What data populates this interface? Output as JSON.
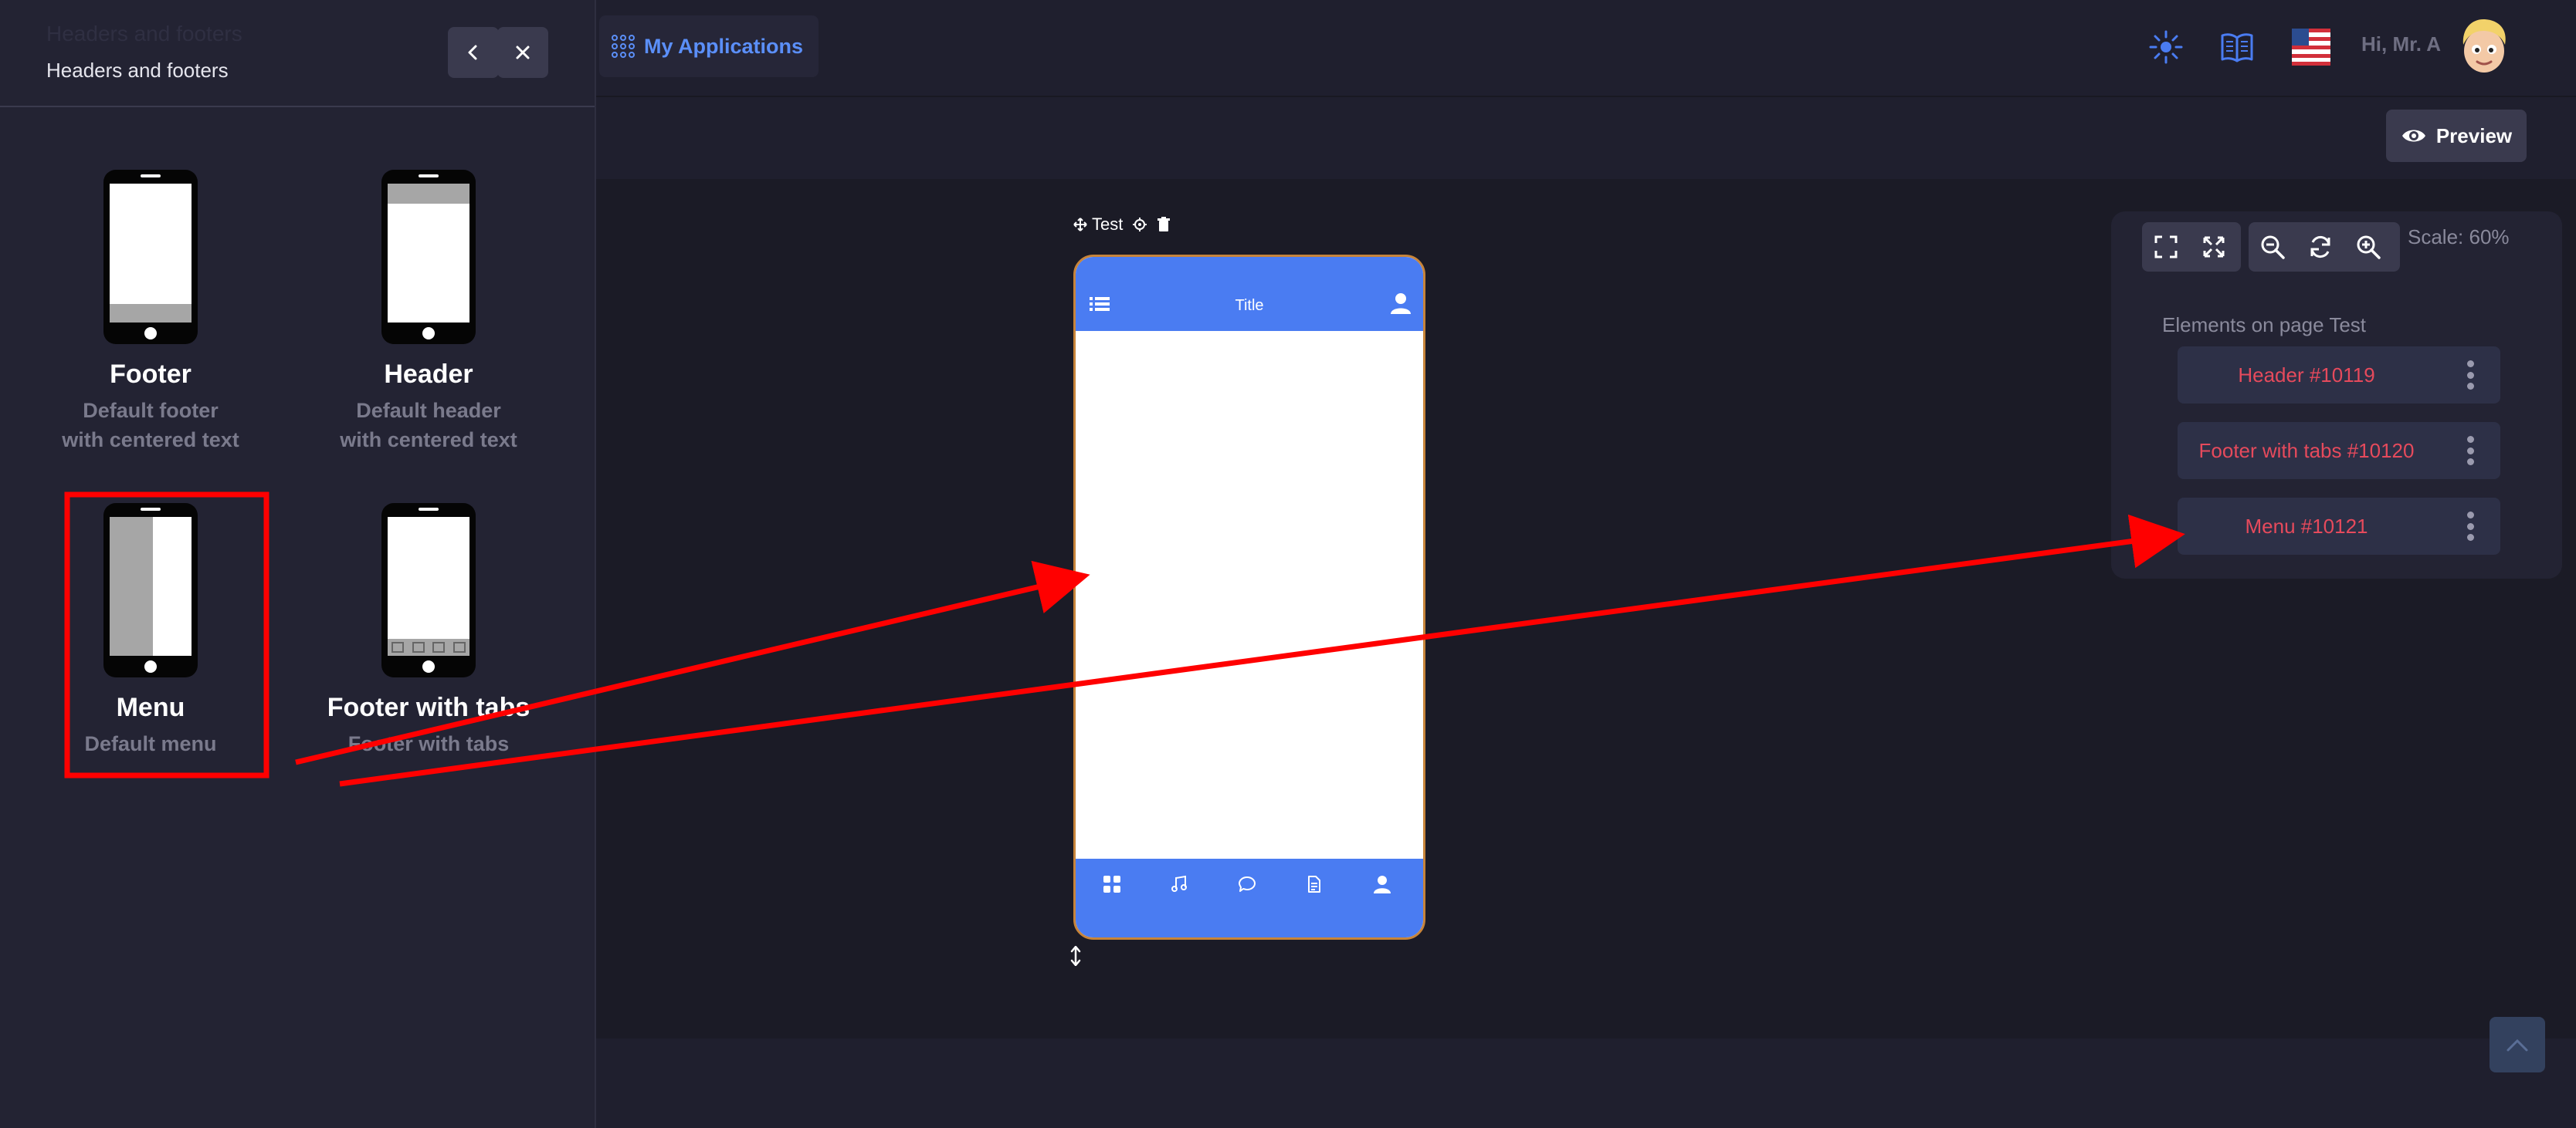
{
  "sidebar": {
    "faded_title": "Headers and footers",
    "subtitle": "Headers and footers",
    "templates": [
      {
        "title": "Footer",
        "description": "Default footer with centered text"
      },
      {
        "title": "Header",
        "description": "Default header with centered text"
      },
      {
        "title": "Menu",
        "description": "Default menu"
      },
      {
        "title": "Footer with tabs",
        "description": "Footer with tabs"
      }
    ]
  },
  "topbar": {
    "apps_label": "My Applications",
    "greeting": "Hi, Mr. A"
  },
  "toolbar": {
    "preview_label": "Preview"
  },
  "canvas": {
    "page_name": "Test",
    "phone_title": "Title"
  },
  "right_panel": {
    "scale": "Scale: 60%",
    "heading": "Elements on page Test",
    "elements": [
      {
        "label": "Header #10119"
      },
      {
        "label": "Footer with tabs #10120"
      },
      {
        "label": "Menu #10121"
      }
    ]
  },
  "colors": {
    "accent_blue": "#4a7cf2",
    "element_red": "#e64a5c",
    "annotation_red": "#ff0000",
    "phone_border": "#c7843a"
  },
  "icons": [
    "chevron-left-icon",
    "close-icon",
    "apps-grid-icon",
    "settings-sun-icon",
    "book-icon",
    "us-flag-icon",
    "avatar",
    "eye-icon",
    "move-icon",
    "gear-icon",
    "trash-icon",
    "list-icon",
    "user-icon",
    "grid-icon",
    "music-icon",
    "chat-icon",
    "document-icon",
    "fullscreen-icon",
    "expand-icon",
    "zoom-out-icon",
    "refresh-icon",
    "zoom-in-icon",
    "kebab-icon",
    "chevron-up-icon"
  ]
}
